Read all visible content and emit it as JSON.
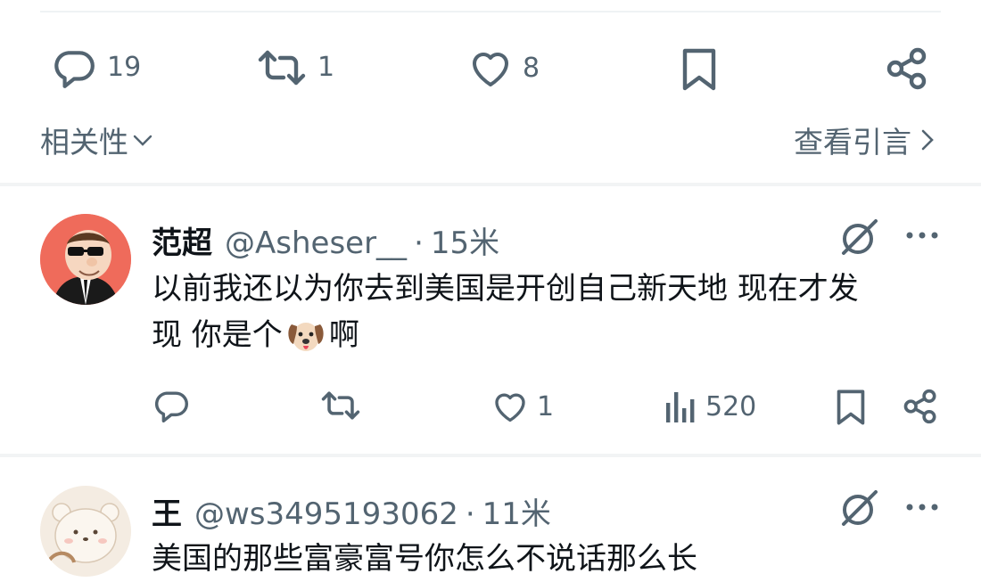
{
  "top_actions": {
    "reply_count": "19",
    "repost_count": "1",
    "like_count": "8"
  },
  "sort": {
    "label": "相关性"
  },
  "quotes": {
    "label": "查看引言"
  },
  "replies": [
    {
      "display_name": "范超",
      "handle": "@Asheser__",
      "sep": "·",
      "time": "15米",
      "text_line1": "以前我还以为你去到美国是开创自己新天地  现在才发",
      "text_line2_a": "现 你是个",
      "text_line2_b": "啊",
      "like_count": "1",
      "view_count": "520"
    },
    {
      "display_name": "王",
      "handle": "@ws3495193062",
      "sep": "·",
      "time": "11米",
      "text_line1": "美国的那些富豪富号你怎么不说话那么长"
    }
  ],
  "colors": {
    "muted": "#536471",
    "text": "#0f1419",
    "divider": "#eff3f4"
  }
}
